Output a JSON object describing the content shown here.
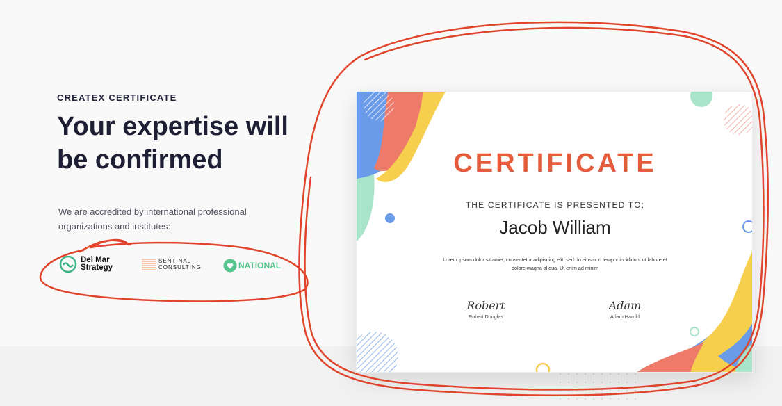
{
  "eyebrow": "CREATEX CERTIFICATE",
  "headline": "Your expertise will be confirmed",
  "description": "We are accredited by international professional organizations and institutes:",
  "partners": {
    "delmar_line1": "Del Mar",
    "delmar_line2": "Strategy",
    "sentinal_line1": "SENTINAL",
    "sentinal_line2": "CONSULTING",
    "national": "NATIONAL"
  },
  "certificate": {
    "title": "CERTIFICATE",
    "subtitle": "THE CERTIFICATE IS PRESENTED TO:",
    "recipient": "Jacob William",
    "body": "Lorem ipsum dolor sit amet, consectetur adipiscing elit, sed do eiusmod tempor incididunt ut labore et dolore magna aliqua. Ut enim ad minim",
    "signatures": [
      {
        "script": "Robert",
        "name": "Robert Douglas"
      },
      {
        "script": "Adam",
        "name": "Adam Harold"
      }
    ]
  },
  "colors": {
    "accent_orange": "#e55c3c",
    "blue": "#6a9be8",
    "yellow": "#f7cf4f",
    "salmon": "#ee7b6a",
    "mint": "#a8e4c9",
    "national_green": "#58c48e",
    "annotation_red": "#e0452c"
  },
  "icons": [
    "delmar-logo-icon",
    "sentinal-logo-icon",
    "national-heart-icon"
  ]
}
